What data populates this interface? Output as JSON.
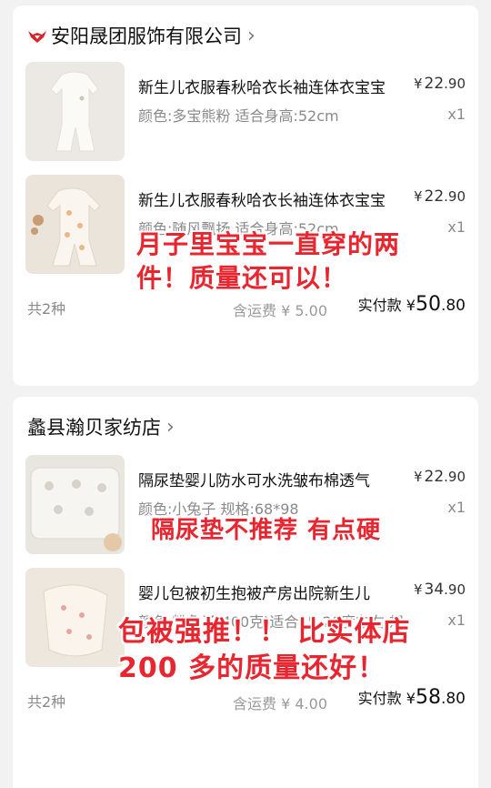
{
  "shops": [
    {
      "name": "安阳晟团服饰有限公司",
      "items": [
        {
          "title": "新生儿衣服春秋哈衣长袖连体衣宝宝",
          "spec": "颜色:多宝熊粉  适合身高:52cm",
          "price_yen": "¥",
          "price_int": "22",
          "price_dec": ".90",
          "qty": "x1"
        },
        {
          "title": "新生儿衣服春秋哈衣长袖连体衣宝宝",
          "spec": "颜色:随风飘扬  适合身高:52cm",
          "price_yen": "¥",
          "price_int": "22",
          "price_dec": ".90",
          "qty": "x1"
        }
      ],
      "count": "共2种",
      "shipping": "含运费 ¥ 5.00",
      "paid_label": "实付款",
      "paid_yen": "¥",
      "paid_int": "50",
      "paid_dec": ".80"
    },
    {
      "name": "蠡县瀚贝家纺店",
      "items": [
        {
          "title": "隔尿垫婴儿防水可水洗皱布棉透气",
          "spec": "颜色:小兔子  规格:68*98",
          "price_yen": "¥",
          "price_int": "22",
          "price_dec": ".90",
          "qty": "x1"
        },
        {
          "title": "婴儿包被初生抱被产房出院新生儿",
          "spec": "颜色:粉兔子(400克)适合15-20度左右 规",
          "price_yen": "¥",
          "price_int": "34",
          "price_dec": ".90",
          "qty": "x1"
        }
      ],
      "count": "共2种",
      "shipping": "含运费 ¥ 4.00",
      "paid_label": "实付款",
      "paid_yen": "¥",
      "paid_int": "58",
      "paid_dec": ".80"
    }
  ],
  "annotations": {
    "a1_line1": "月子里宝宝一直穿的两",
    "a1_line2": "件！质量还可以！",
    "a2": "隔尿垫不推荐 有点硬",
    "a3_line1": "包被强推！！ 比实体店",
    "a3_line2": "200 多的质量还好！"
  },
  "colors": {
    "annotation": "#e8262f",
    "background": "#f2f2f2",
    "card": "#ffffff",
    "muted": "#8a8a8a"
  },
  "icons": {
    "shop1_logo": "red-bull-shop-logo-icon",
    "shop_chevron": "chevron-right-icon"
  }
}
